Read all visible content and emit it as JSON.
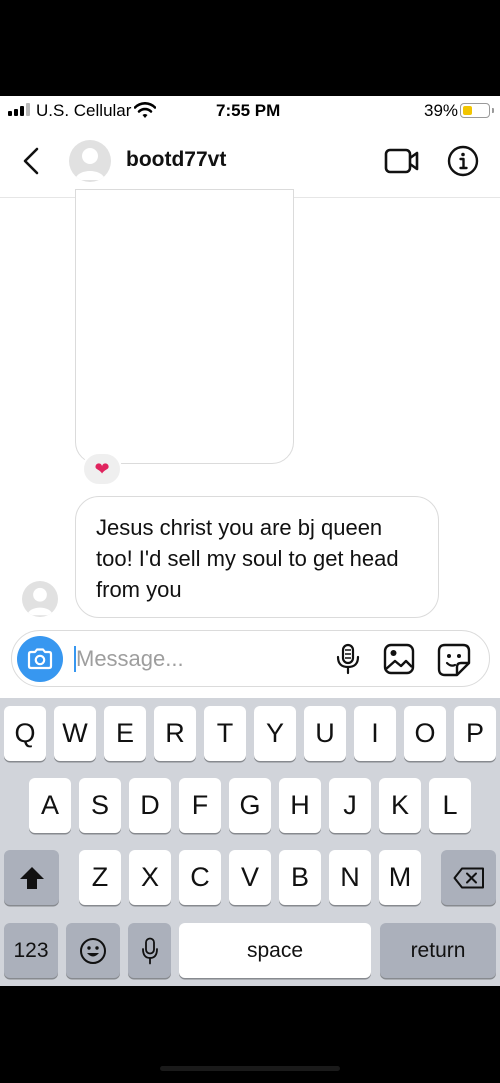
{
  "status_bar": {
    "carrier": "U.S. Cellular",
    "time": "7:55 PM",
    "battery_percent": "39%",
    "battery_level": 0.39,
    "signal_bars": 3
  },
  "header": {
    "username": "bootd77vt",
    "back_icon": "chevron-left-icon",
    "video_icon": "video-camera-icon",
    "info_icon": "info-icon"
  },
  "chat": {
    "reaction": "❤",
    "message_text": "Jesus christ you are bj queen too! I'd sell my soul to get head from you"
  },
  "composer": {
    "placeholder": "Message...",
    "value": "",
    "accent_color": "#3797f0"
  },
  "keyboard": {
    "row1": [
      "Q",
      "W",
      "E",
      "R",
      "T",
      "Y",
      "U",
      "I",
      "O",
      "P"
    ],
    "row2": [
      "A",
      "S",
      "D",
      "F",
      "G",
      "H",
      "J",
      "K",
      "L"
    ],
    "row3": [
      "Z",
      "X",
      "C",
      "V",
      "B",
      "N",
      "M"
    ],
    "numbers_label": "123",
    "space_label": "space",
    "return_label": "return"
  }
}
